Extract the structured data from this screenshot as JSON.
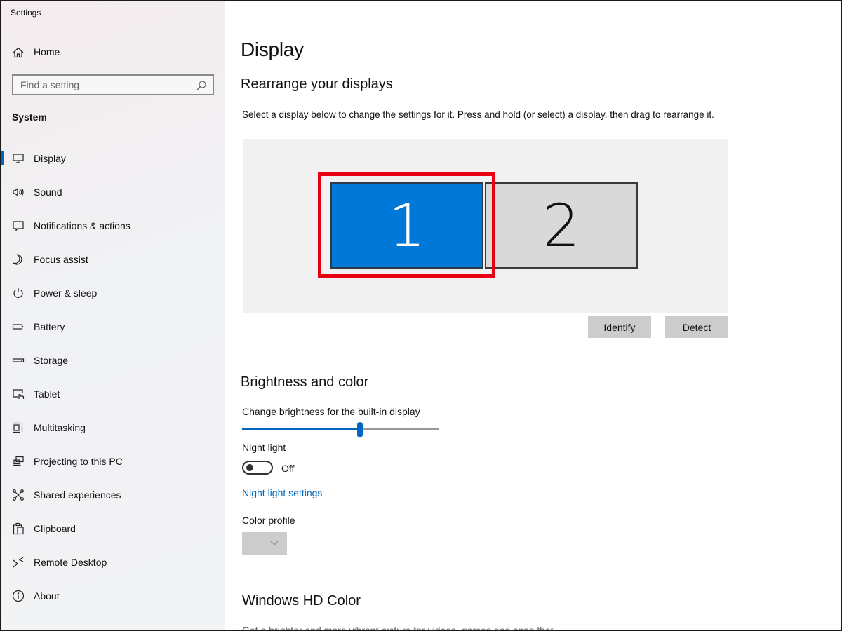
{
  "window": {
    "title": "Settings"
  },
  "sidebar": {
    "home_label": "Home",
    "search": {
      "placeholder": "Find a setting",
      "value": ""
    },
    "section_label": "System",
    "items": [
      {
        "label": "Display",
        "icon": "monitor-icon",
        "active": true
      },
      {
        "label": "Sound",
        "icon": "speaker-icon",
        "active": false
      },
      {
        "label": "Notifications & actions",
        "icon": "notification-icon",
        "active": false
      },
      {
        "label": "Focus assist",
        "icon": "moon-icon",
        "active": false
      },
      {
        "label": "Power & sleep",
        "icon": "power-icon",
        "active": false
      },
      {
        "label": "Battery",
        "icon": "battery-icon",
        "active": false
      },
      {
        "label": "Storage",
        "icon": "storage-icon",
        "active": false
      },
      {
        "label": "Tablet",
        "icon": "tablet-icon",
        "active": false
      },
      {
        "label": "Multitasking",
        "icon": "multitasking-icon",
        "active": false
      },
      {
        "label": "Projecting to this PC",
        "icon": "projecting-icon",
        "active": false
      },
      {
        "label": "Shared experiences",
        "icon": "shared-experiences-icon",
        "active": false
      },
      {
        "label": "Clipboard",
        "icon": "clipboard-icon",
        "active": false
      },
      {
        "label": "Remote Desktop",
        "icon": "remote-desktop-icon",
        "active": false
      },
      {
        "label": "About",
        "icon": "info-icon",
        "active": false
      }
    ]
  },
  "main": {
    "title": "Display",
    "rearrange": {
      "heading": "Rearrange your displays",
      "description": "Select a display below to change the settings for it. Press and hold (or select) a display, then drag to rearrange it.",
      "monitors": [
        {
          "label": "1",
          "selected": true
        },
        {
          "label": "2",
          "selected": false
        }
      ],
      "identify_label": "Identify",
      "detect_label": "Detect"
    },
    "brightness": {
      "heading": "Brightness and color",
      "slider_label": "Change brightness for the built-in display",
      "brightness_percent": 60,
      "night_light_label": "Night light",
      "night_light_state": "Off",
      "night_light_on": false,
      "night_light_settings_link": "Night light settings",
      "color_profile_label": "Color profile",
      "color_profile_value": ""
    },
    "hd_color": {
      "heading": "Windows HD Color",
      "description": "Get a brighter and more vibrant picture for videos, games and apps that"
    }
  },
  "colors": {
    "accent": "#0067c0",
    "selected_monitor": "#0078d7",
    "highlight": "#e60012",
    "link": "#0067b8"
  }
}
